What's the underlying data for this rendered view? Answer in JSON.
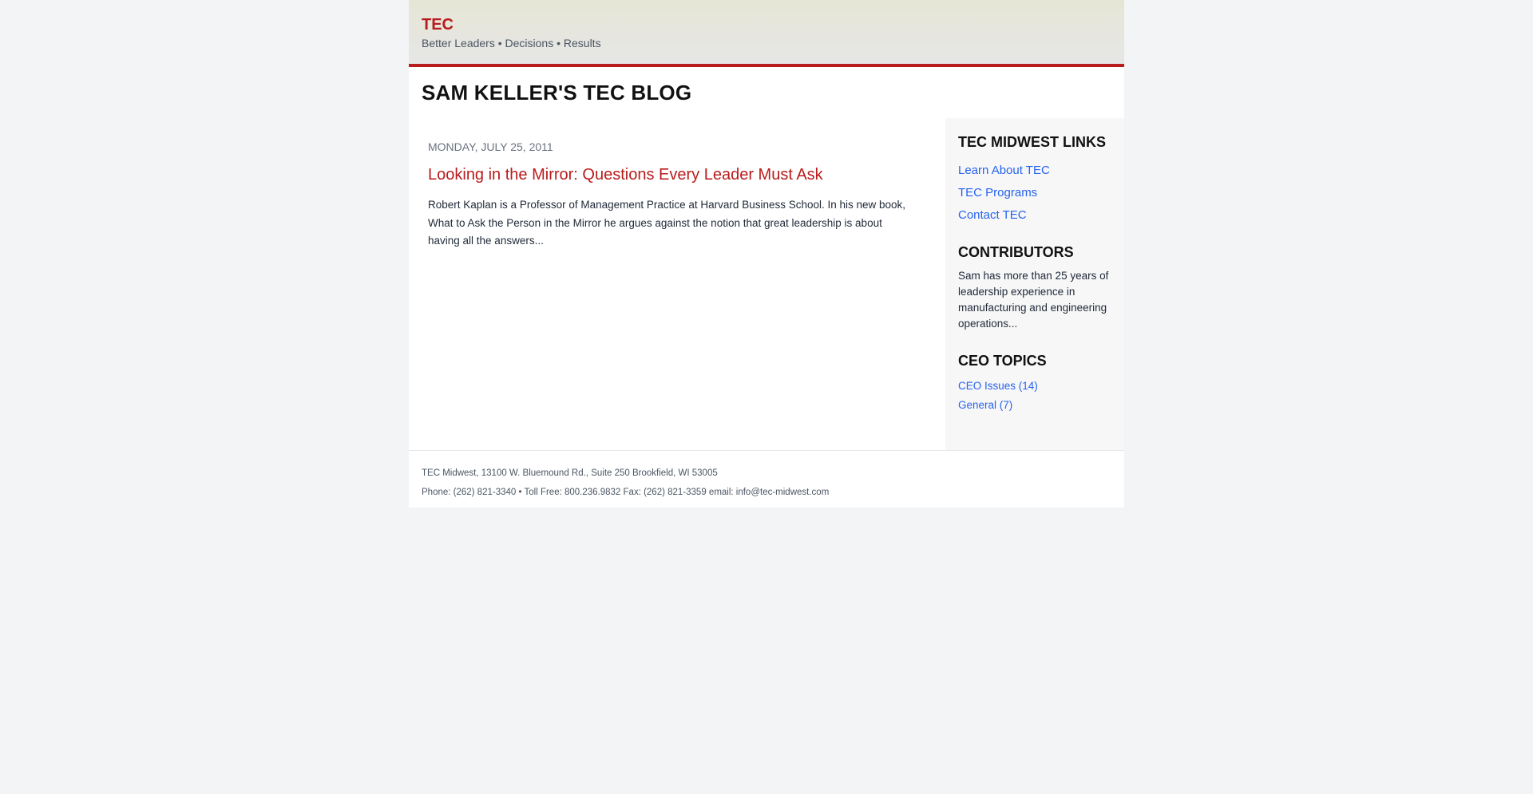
{
  "site": {
    "brand": "TEC",
    "tagline": "Better Leaders • Decisions • Results",
    "blog_title": "SAM KELLER'S TEC BLOG"
  },
  "post": {
    "date": "MONDAY, JULY 25, 2011",
    "title": "Looking in the Mirror: Questions Every Leader Must Ask",
    "excerpt": "Robert Kaplan is a Professor of Management Practice at Harvard Business School. In his new book, What to Ask the Person in the Mirror he argues against the notion that great leadership is about having all the answers..."
  },
  "sidebar": {
    "links_heading": "TEC MIDWEST LINKS",
    "links": [
      {
        "label": "Learn About TEC"
      },
      {
        "label": "TEC Programs"
      },
      {
        "label": "Contact TEC"
      }
    ],
    "contributors_heading": "CONTRIBUTORS",
    "contributors_text": "Sam has more than 25 years of leadership experience in manufacturing and engineering operations...",
    "topics_heading": "CEO TOPICS",
    "topics": [
      {
        "label": "CEO Issues (14)"
      },
      {
        "label": "General (7)"
      }
    ]
  },
  "footer": {
    "address": "TEC Midwest, 13100 W. Bluemound Rd., Suite 250 Brookfield, WI 53005",
    "contact": "Phone: (262) 821-3340 • Toll Free: 800.236.9832 Fax: (262) 821-3359 email: info@tec-midwest.com"
  },
  "colors": {
    "accent": "#b91c1c",
    "link": "#2563eb",
    "background": "#f3f4f6"
  }
}
